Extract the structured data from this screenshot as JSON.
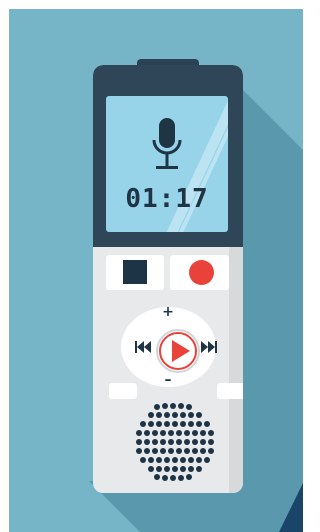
{
  "recorder": {
    "display_time": "01:17",
    "volume_up_label": "+",
    "volume_down_label": "–"
  },
  "colors": {
    "background": "#76b5c8",
    "shadow": "#5a98ad",
    "corner_accent": "#1a4468",
    "device_dark": "#2e4657",
    "device_body": "#e8e9ea",
    "screen": "#97d4ea",
    "record_red": "#e8423b",
    "play_red": "#e8423b",
    "icon_dark": "#1d3447"
  }
}
